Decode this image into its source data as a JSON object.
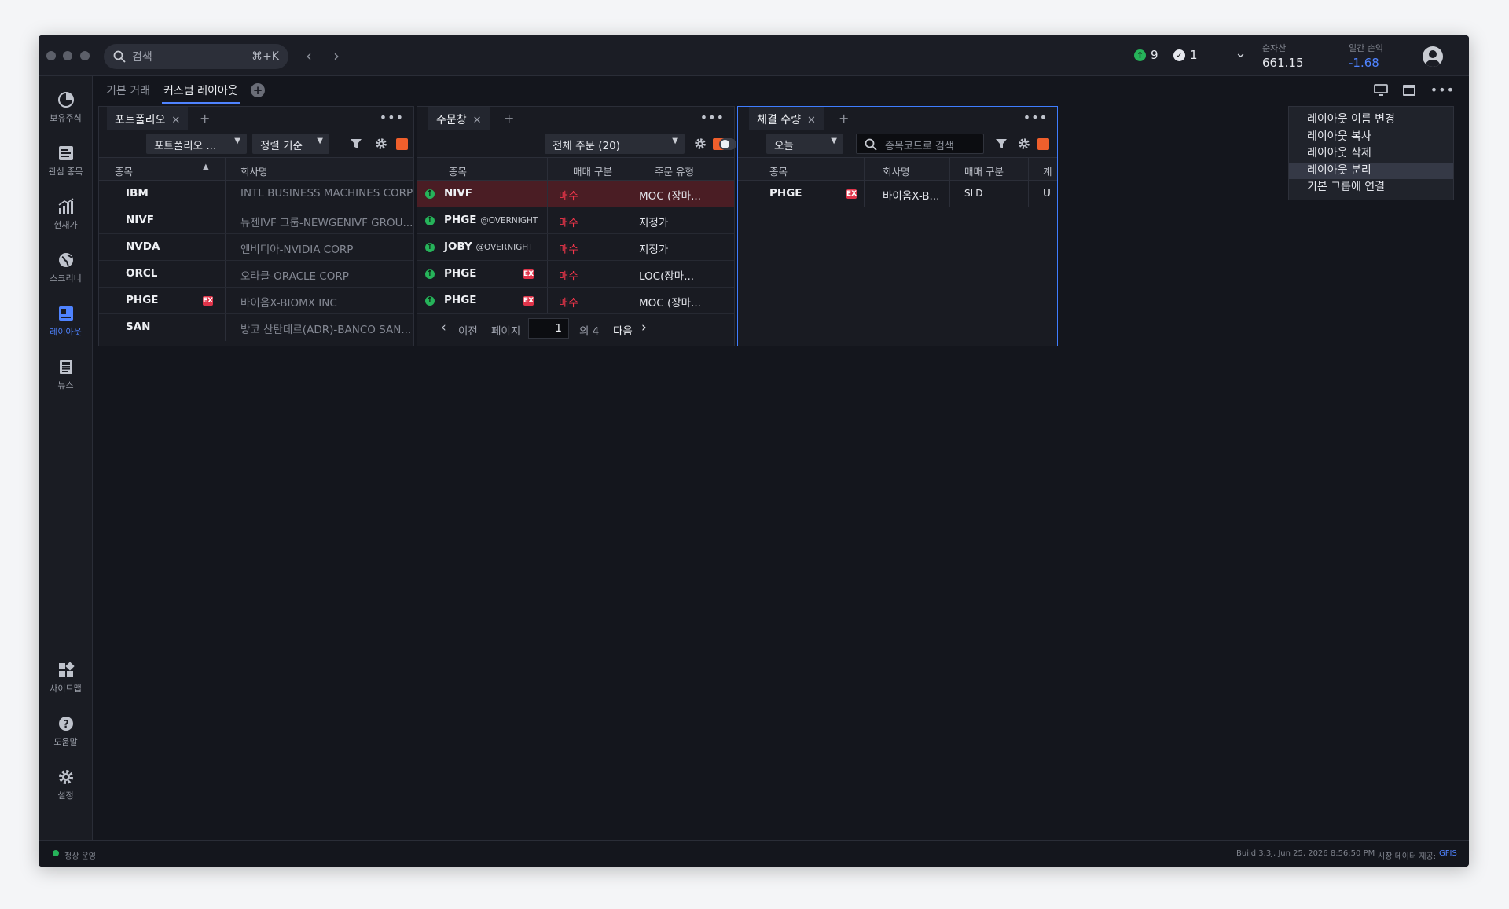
{
  "titlebar": {
    "search_placeholder": "검색",
    "search_shortcut": "⌘+K",
    "status_up_count": "9",
    "status_check_count": "1",
    "net_assets_label": "순자산",
    "net_assets_value": "661.15",
    "daily_pl_label": "일간 손익",
    "daily_pl_value": "-1.68",
    "daily_pl_color": "#4f83ff"
  },
  "sidebar": {
    "items": [
      {
        "label": "보유주식",
        "icon": "holdings-icon"
      },
      {
        "label": "관심 종목",
        "icon": "watchlist-icon"
      },
      {
        "label": "현재가",
        "icon": "price-chart-icon"
      },
      {
        "label": "스크리너",
        "icon": "globe-icon"
      },
      {
        "label": "레이아웃",
        "icon": "layout-icon"
      },
      {
        "label": "뉴스",
        "icon": "news-icon"
      },
      {
        "label": "사이트맵",
        "icon": "sitemap-icon"
      },
      {
        "label": "도움말",
        "icon": "help-icon"
      },
      {
        "label": "설정",
        "icon": "gear-icon"
      }
    ]
  },
  "tabs": [
    {
      "label": "기본 거래"
    },
    {
      "label": "커스텀 레이아웃"
    }
  ],
  "portfolio": {
    "tab": "포트폴리오",
    "select_label": "포트폴리오 ...",
    "sort_label": "정렬 기준",
    "col_symbol": "종목",
    "col_name": "회사명",
    "rows": [
      {
        "symbol": "IBM",
        "name": "INTL BUSINESS MACHINES CORP"
      },
      {
        "symbol": "NIVF",
        "name": "뉴젠IVF 그룹-NEWGENIVF GROU..."
      },
      {
        "symbol": "NVDA",
        "name": "엔비디아-NVIDIA CORP"
      },
      {
        "symbol": "ORCL",
        "name": "오라클-ORACLE CORP"
      },
      {
        "symbol": "PHGE",
        "name": "바이옴X-BIOMX INC",
        "ex": "EX"
      },
      {
        "symbol": "SAN",
        "name": "방코 산탄데르(ADR)-BANCO SAN..."
      }
    ]
  },
  "orders": {
    "tab": "주문창",
    "filter_label": "전체 주문 (20)",
    "col_symbol": "종목",
    "col_side": "매매 구분",
    "col_type": "주문 유형",
    "rows": [
      {
        "symbol": "NIVF",
        "tag": "",
        "ex": "",
        "side": "매수",
        "type": "MOC (장마..."
      },
      {
        "symbol": "PHGE",
        "tag": "@OVERNIGHT",
        "ex": "",
        "side": "매수",
        "type": "지정가"
      },
      {
        "symbol": "JOBY",
        "tag": "@OVERNIGHT",
        "ex": "",
        "side": "매수",
        "type": "지정가"
      },
      {
        "symbol": "PHGE",
        "tag": "",
        "ex": "EX",
        "side": "매수",
        "type": "LOC(장마..."
      },
      {
        "symbol": "PHGE",
        "tag": "",
        "ex": "EX",
        "side": "매수",
        "type": "MOC (장마..."
      }
    ],
    "pager": {
      "prev": "이전",
      "page_label": "페이지",
      "page_value": "1",
      "of_label": "의 4",
      "next": "다음"
    }
  },
  "fills": {
    "tab": "체결 수량",
    "period_label": "오늘",
    "search_placeholder": "종목코드로 검색",
    "col_symbol": "종목",
    "col_name": "회사명",
    "col_side": "매매 구분",
    "col_acct": "계",
    "rows": [
      {
        "symbol": "PHGE",
        "ex": "EX",
        "name": "바이옴X-B...",
        "side": "SLD",
        "acct": "U"
      }
    ]
  },
  "context_menu": {
    "items": [
      "레이아웃 이름 변경",
      "레이아웃 복사",
      "레이아웃 삭제",
      "레이아웃 분리",
      "기본 그룹에 연결"
    ]
  },
  "footer": {
    "status": "정상 운영",
    "build": "Build 3.3j, Jun 25, 2026 8:56:50 PM",
    "data_label": "시장 데이터 제공:",
    "data_provider": "GFIS"
  }
}
